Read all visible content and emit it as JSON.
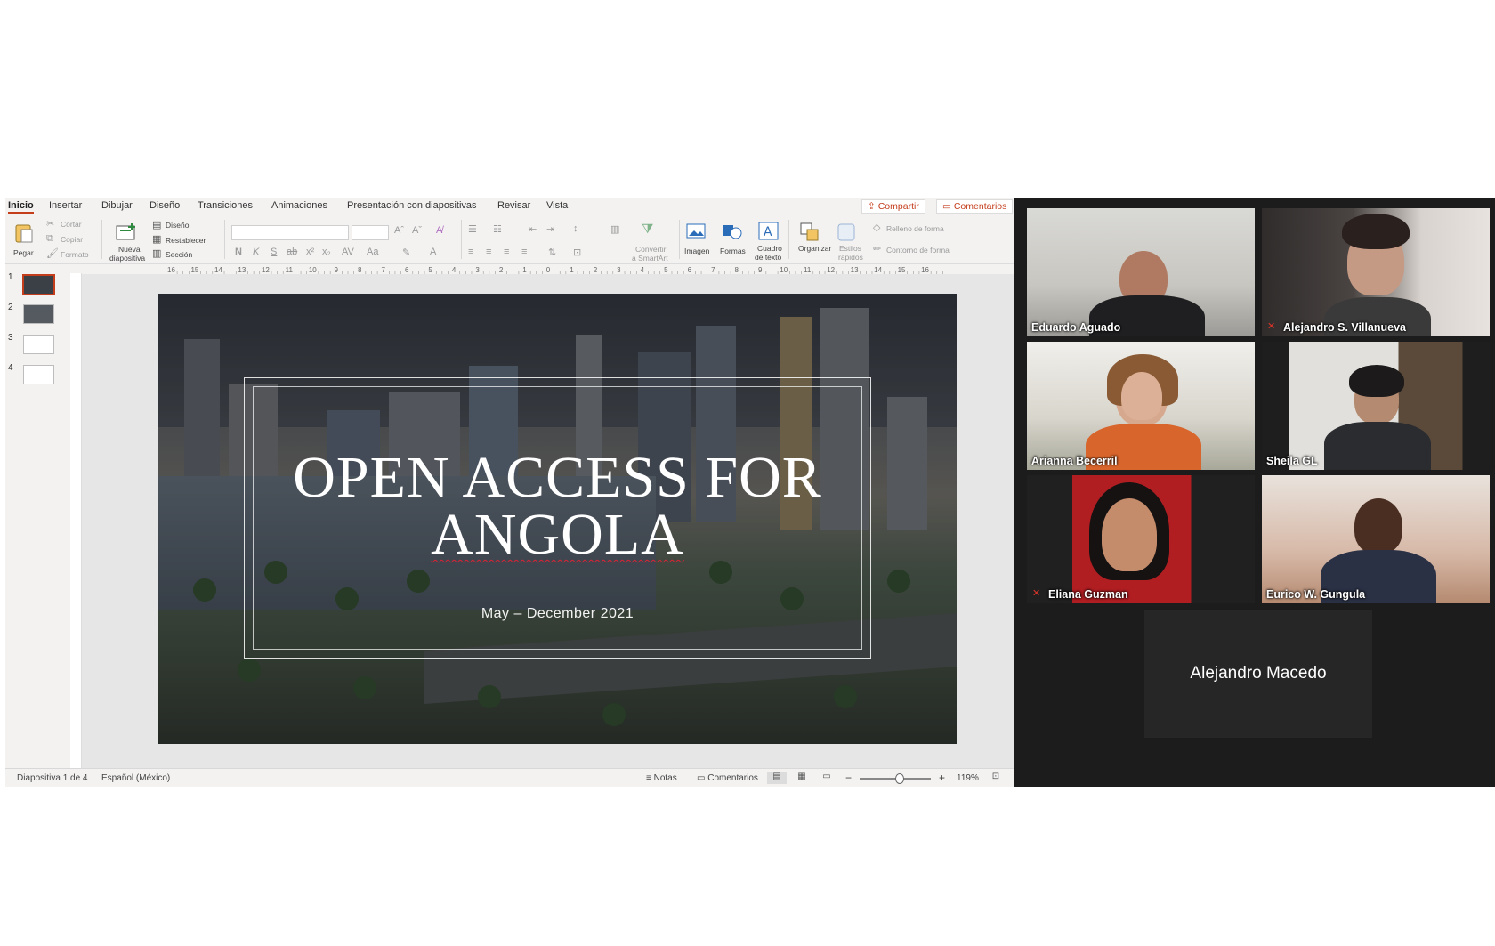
{
  "ribbon_tabs": [
    "Inicio",
    "Insertar",
    "Dibujar",
    "Diseño",
    "Transiciones",
    "Animaciones",
    "Presentación con diapositivas",
    "Revisar",
    "Vista"
  ],
  "actions": {
    "share": "Compartir",
    "comments": "Comentarios"
  },
  "ribbon": {
    "paste": "Pegar",
    "cut": "Cortar",
    "copy": "Copiar",
    "format": "Formato",
    "new_slide_1": "Nueva",
    "new_slide_2": "diapositiva",
    "layout": "Diseño",
    "reset": "Restablecer",
    "section": "Sección",
    "bold": "N",
    "italic": "K",
    "underline": "S",
    "strike": "ab",
    "superscript": "x²",
    "subscript": "x₂",
    "spacing": "AV",
    "case": "Aa",
    "smartart_1": "Convertir",
    "smartart_2": "a SmartArt",
    "image": "Imagen",
    "shapes": "Formas",
    "textbox_1": "Cuadro",
    "textbox_2": "de texto",
    "arrange": "Organizar",
    "quick_styles_1": "Estilos",
    "quick_styles_2": "rápidos",
    "shape_fill": "Relleno de forma",
    "shape_outline": "Contorno de forma"
  },
  "ruler_ticks": [
    "16",
    "15",
    "14",
    "13",
    "12",
    "11",
    "10",
    "9",
    "8",
    "7",
    "6",
    "5",
    "4",
    "3",
    "2",
    "1",
    "0",
    "1",
    "2",
    "3",
    "4",
    "5",
    "6",
    "7",
    "8",
    "9",
    "10",
    "11",
    "12",
    "13",
    "14",
    "15",
    "16"
  ],
  "thumbnails": [
    "1",
    "2",
    "3",
    "4"
  ],
  "slide": {
    "title_line1": "OPEN ACCESS FOR",
    "title_line2": "ANGOLA",
    "subtitle": "May – December 2021"
  },
  "status": {
    "slide_info": "Diapositiva 1 de 4",
    "language": "Español (México)",
    "notes": "Notas",
    "comments": "Comentarios",
    "zoom_minus": "−",
    "zoom_plus": "+",
    "zoom": "119%"
  },
  "participants": [
    {
      "name": "Eduardo Aguado",
      "muted": false,
      "speaking": false
    },
    {
      "name": "Alejandro S. Villanueva",
      "muted": true,
      "speaking": false
    },
    {
      "name": "Arianna Becerril",
      "muted": false,
      "speaking": false
    },
    {
      "name": "Sheila GL",
      "muted": false,
      "speaking": false
    },
    {
      "name": "Eliana Guzman",
      "muted": true,
      "speaking": false
    },
    {
      "name": "Eurico W. Gungula",
      "muted": false,
      "speaking": true
    }
  ],
  "name_only_participant": "Alejandro Macedo",
  "colors": {
    "accent": "#c43e1c",
    "active_speaker": "#b7e24a",
    "gallery_bg": "#1c1c1c"
  }
}
